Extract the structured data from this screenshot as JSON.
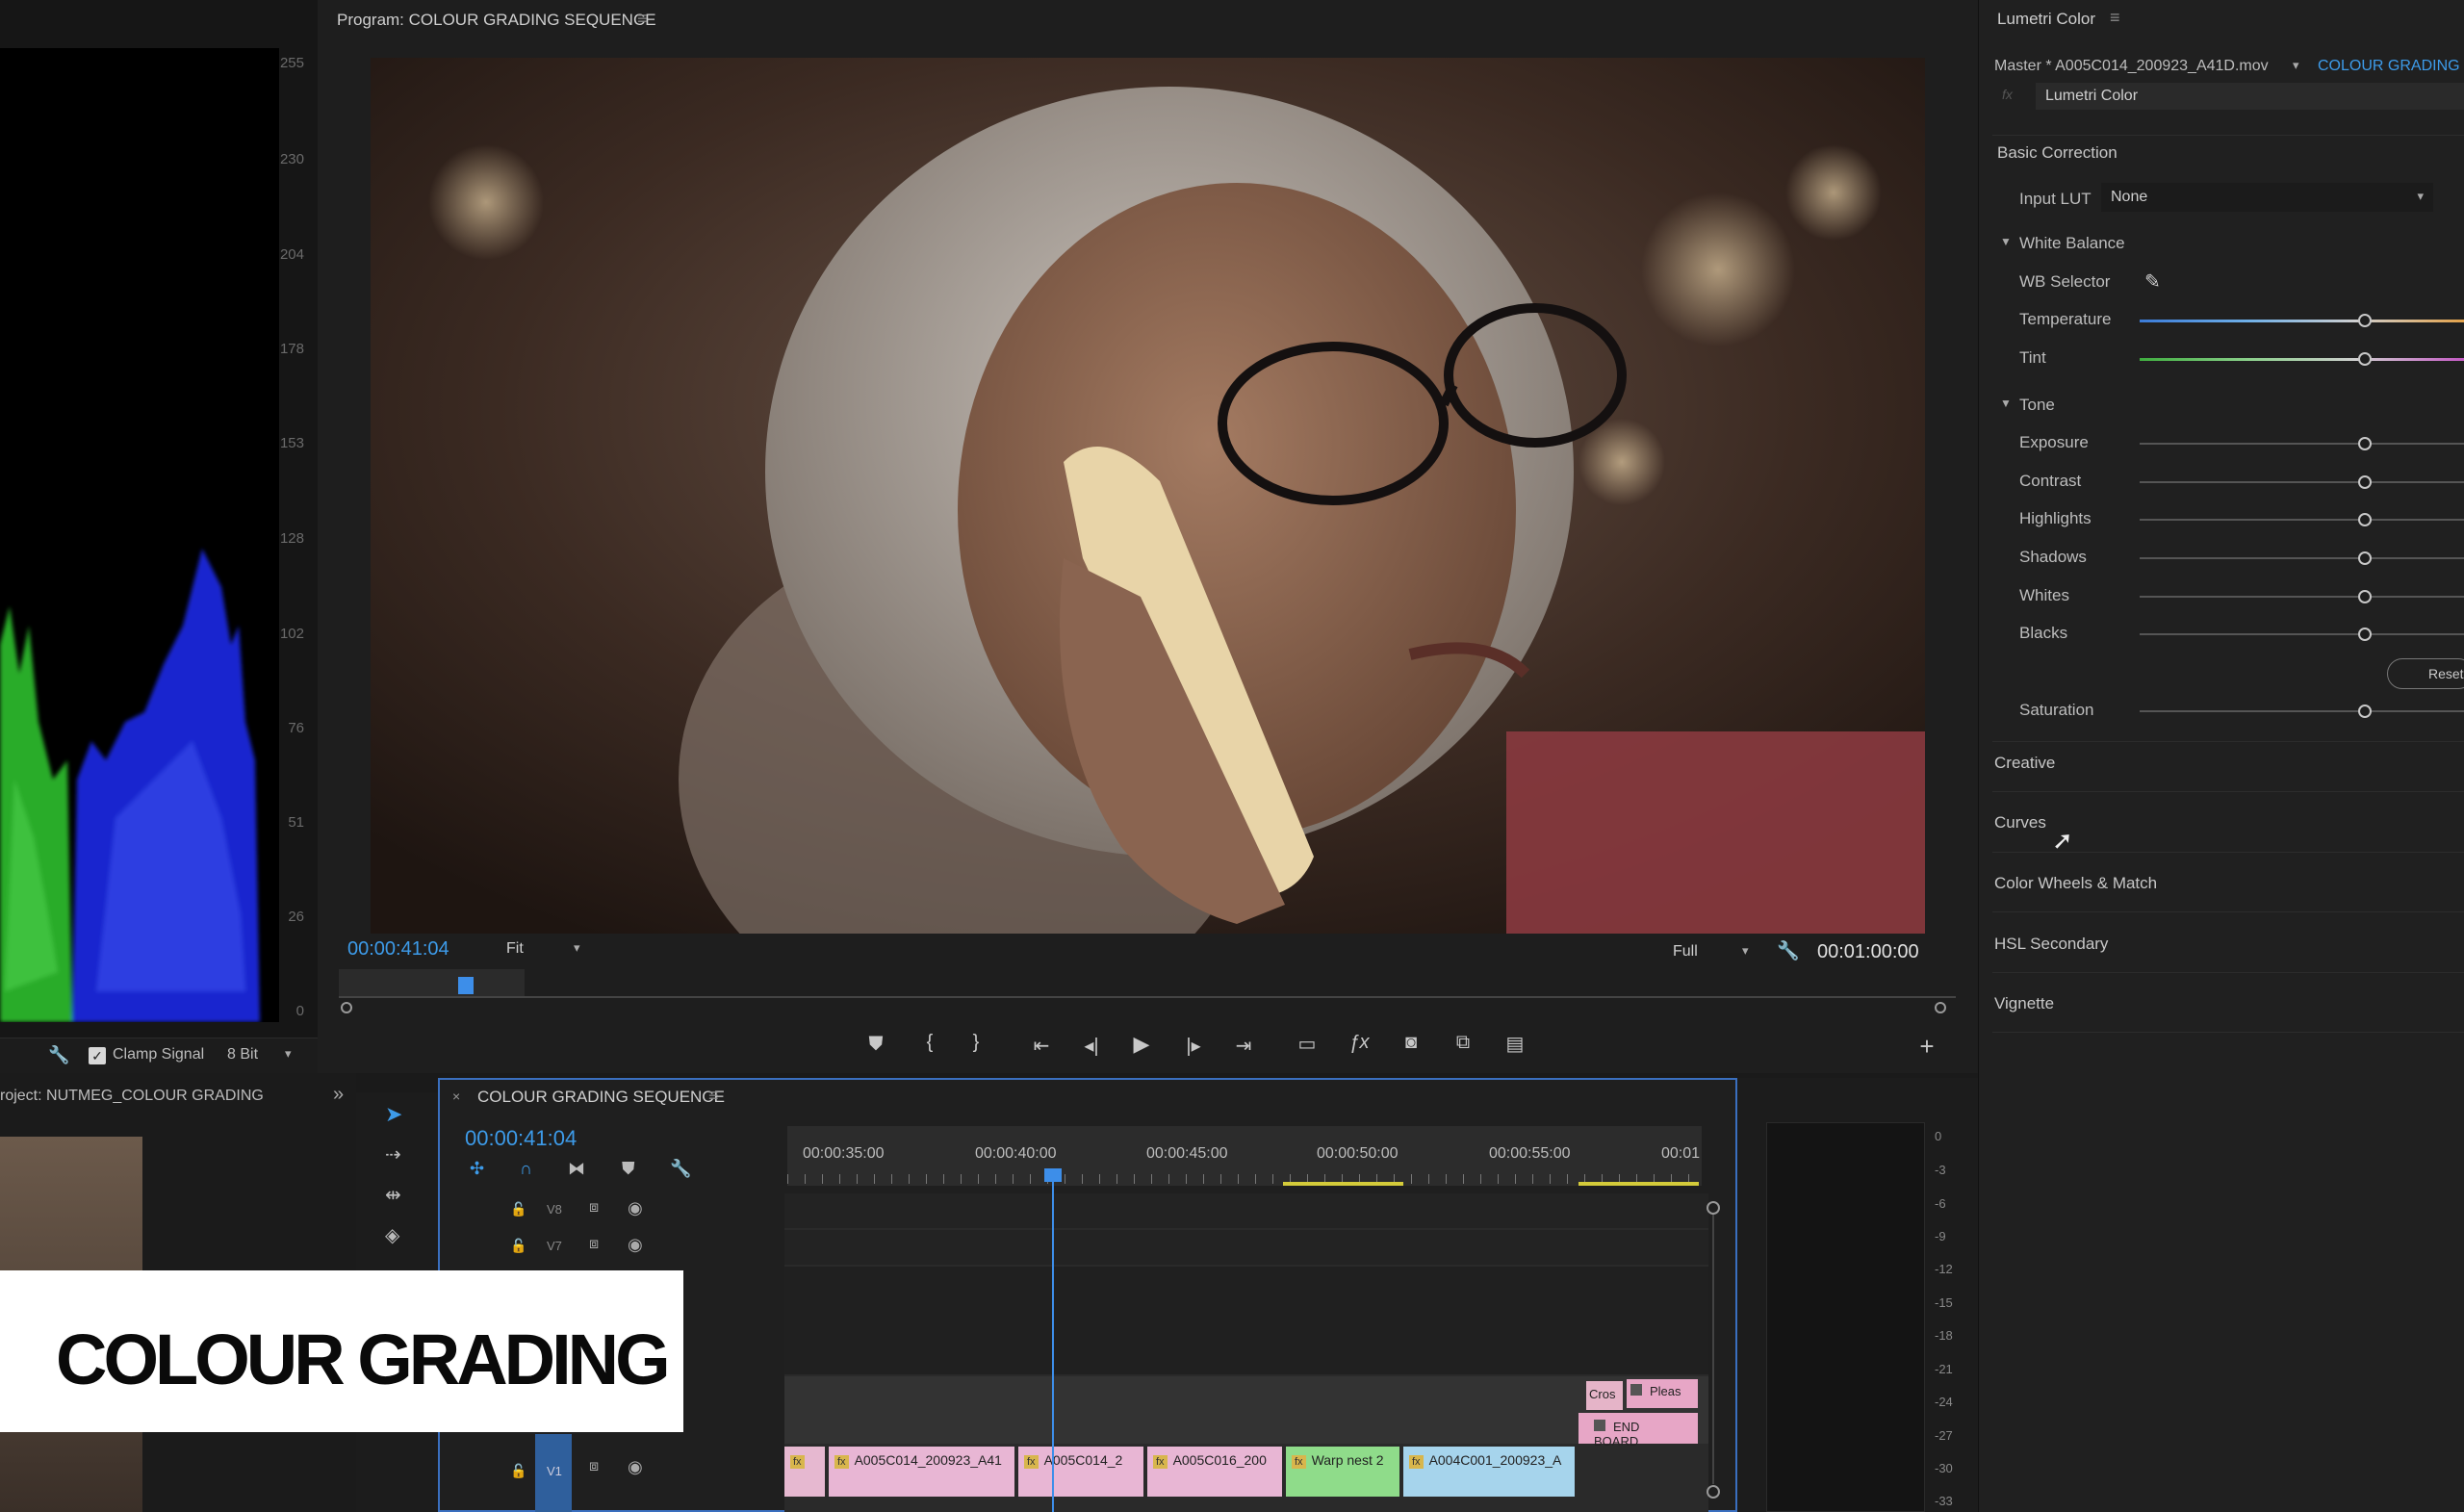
{
  "scope": {
    "ticks": [
      "255",
      "230",
      "204",
      "178",
      "153",
      "128",
      "102",
      "76",
      "51",
      "26",
      "0"
    ],
    "clamp_label": "Clamp Signal",
    "bit_depth": "8 Bit"
  },
  "program": {
    "title": "Program: COLOUR GRADING SEQUENCE",
    "timecode": "00:00:41:04",
    "fit": "Fit",
    "quality": "Full",
    "duration": "00:01:00:00"
  },
  "lumetri": {
    "title": "Lumetri Color",
    "master": "Master * A005C014_200923_A41D.mov",
    "sequence_link": "COLOUR GRADING S",
    "effect": "Lumetri Color",
    "basic_correction": "Basic Correction",
    "input_lut_label": "Input LUT",
    "input_lut_value": "None",
    "white_balance": "White Balance",
    "wb_selector": "WB Selector",
    "temperature": "Temperature",
    "tint": "Tint",
    "tone": "Tone",
    "exposure": "Exposure",
    "contrast": "Contrast",
    "highlights": "Highlights",
    "shadows": "Shadows",
    "whites": "Whites",
    "blacks": "Blacks",
    "reset": "Reset",
    "saturation": "Saturation",
    "creative": "Creative",
    "curves": "Curves",
    "color_wheels": "Color Wheels & Match",
    "hsl": "HSL Secondary",
    "vignette": "Vignette"
  },
  "project": {
    "title": "roject: NUTMEG_COLOUR GRADING"
  },
  "timeline": {
    "title": "COLOUR GRADING SEQUENCE",
    "timecode": "00:00:41:04",
    "ruler": [
      "00:00:35:00",
      "00:00:40:00",
      "00:00:45:00",
      "00:00:50:00",
      "00:00:55:00",
      "00:01"
    ],
    "tracks": {
      "v8": "V8",
      "v7": "V7",
      "v1": "V1"
    },
    "clips": [
      "A005C014_200923_A41",
      "A005C014_2",
      "A005C016_200",
      "Warp nest 2",
      "A004C001_200923_A"
    ],
    "upper_clips": {
      "cross": "Cros",
      "please": "Pleas",
      "end_board": "END BOARD"
    }
  },
  "meter": {
    "db": [
      "0",
      "-3",
      "-6",
      "-9",
      "-12",
      "-15",
      "-18",
      "-21",
      "-24",
      "-27",
      "-30",
      "-33"
    ]
  },
  "overlay": {
    "title": "COLOUR GRADING"
  }
}
